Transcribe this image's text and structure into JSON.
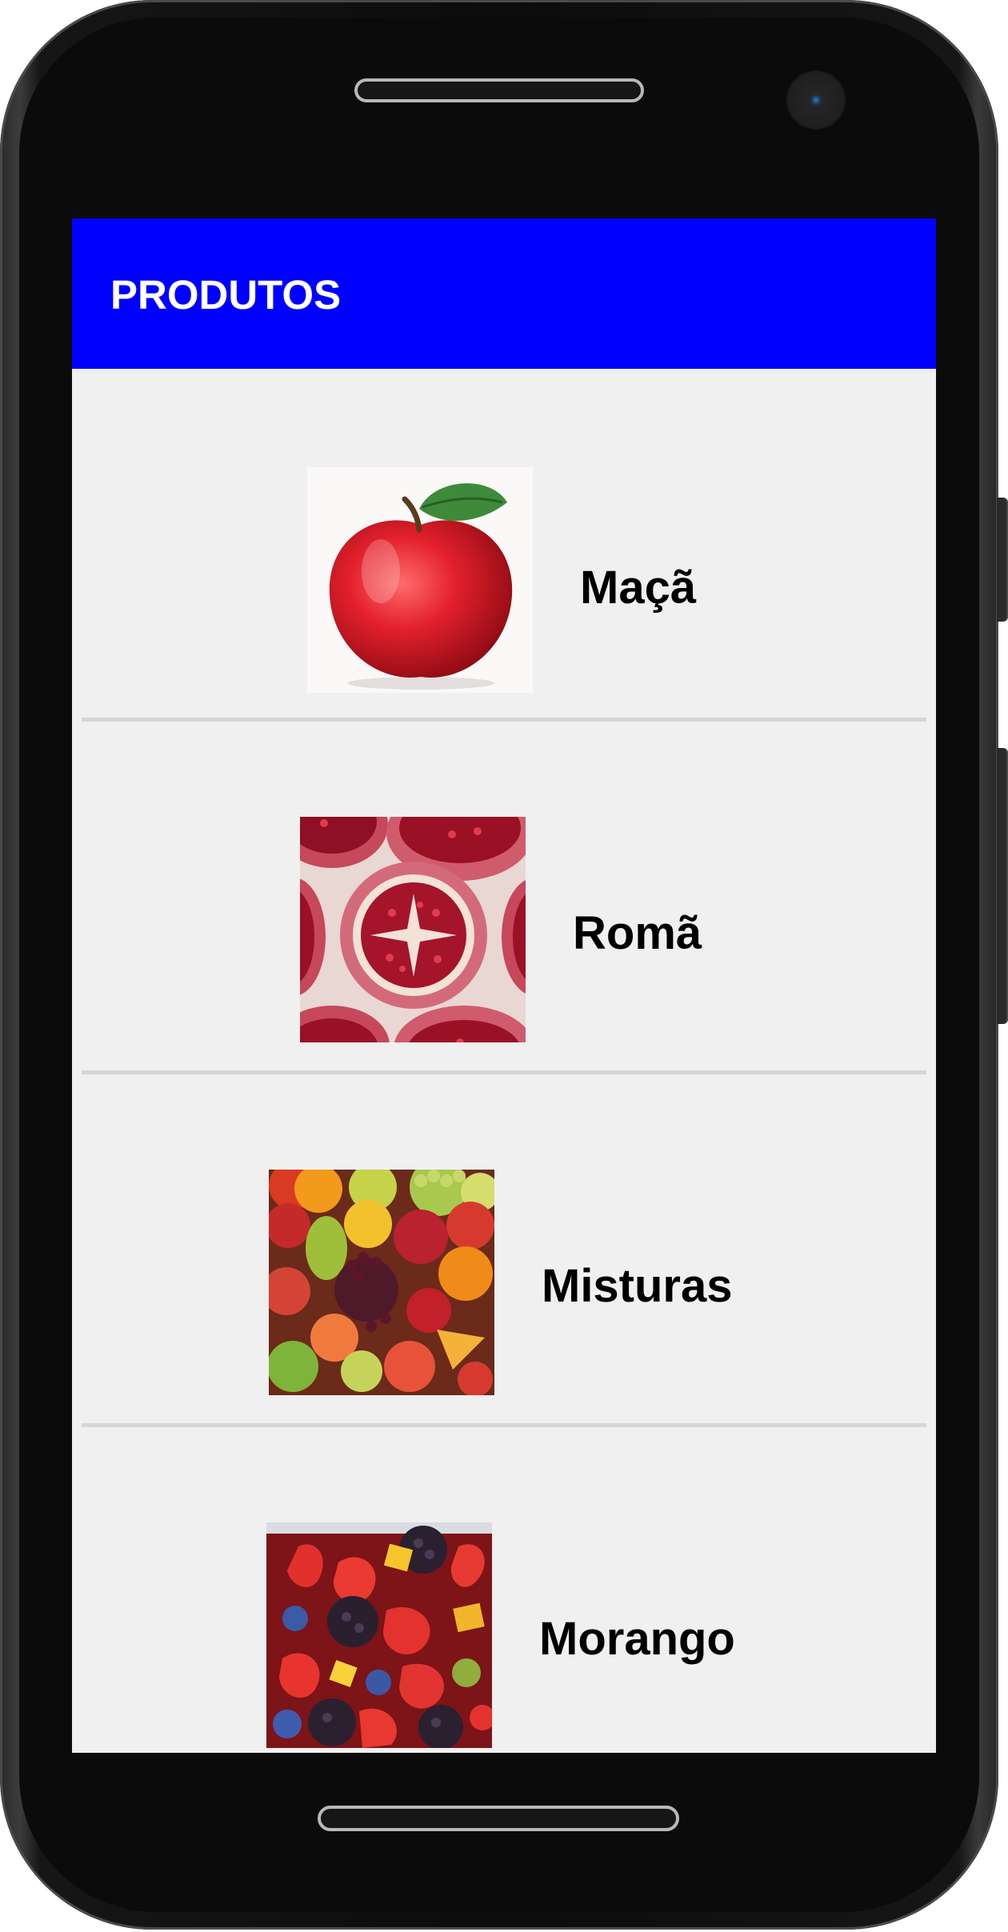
{
  "appbar": {
    "title": "PRODUTOS",
    "background_color": "#0000ff"
  },
  "products": [
    {
      "name": "Maçã",
      "image": "apple-image"
    },
    {
      "name": "Romã",
      "image": "pomegranate-image"
    },
    {
      "name": "Misturas",
      "image": "mixed-fruits-image"
    },
    {
      "name": "Morango",
      "image": "strawberry-salad-image"
    }
  ]
}
